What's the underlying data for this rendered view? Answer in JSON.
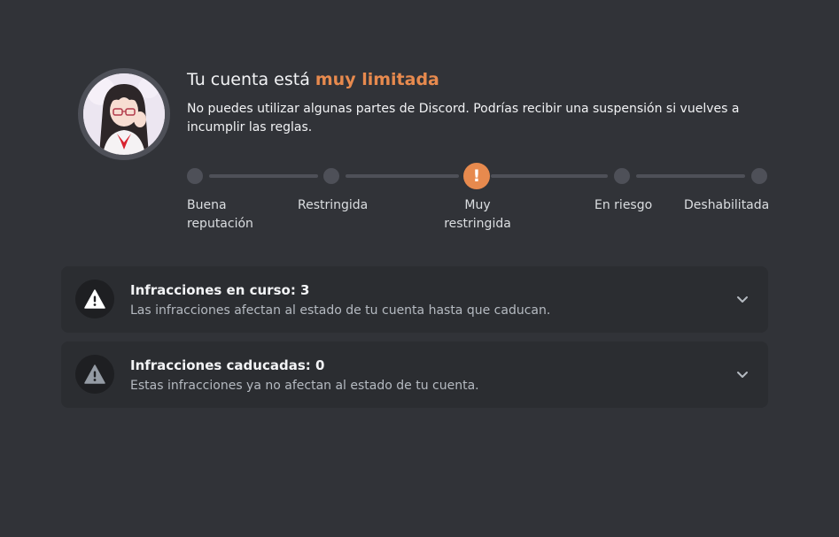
{
  "header": {
    "title_prefix": "Tu cuenta está ",
    "title_accent": "muy limitada",
    "description": "No puedes utilizar algunas partes de Discord. Podrías recibir una suspensión si vuelves a incumplir las reglas."
  },
  "status_track": {
    "active_icon": "!",
    "steps": [
      {
        "label": "Buena reputación",
        "active": false
      },
      {
        "label": "Restringida",
        "active": false
      },
      {
        "label": "Muy restringida",
        "active": true
      },
      {
        "label": "En riesgo",
        "active": false
      },
      {
        "label": "Deshabilitada",
        "active": false
      }
    ]
  },
  "cards": [
    {
      "title": "Infracciones en curso: 3",
      "description": "Las infracciones afectan al estado de tu cuenta hasta que caducan.",
      "icon": "warning-icon"
    },
    {
      "title": "Infracciones caducadas: 0",
      "description": "Estas infracciones ya no afectan al estado de tu cuenta.",
      "icon": "warning-icon"
    }
  ],
  "colors": {
    "background": "#313338",
    "card": "#2b2d31",
    "accent": "#e78a4e",
    "track": "#4e5058"
  }
}
